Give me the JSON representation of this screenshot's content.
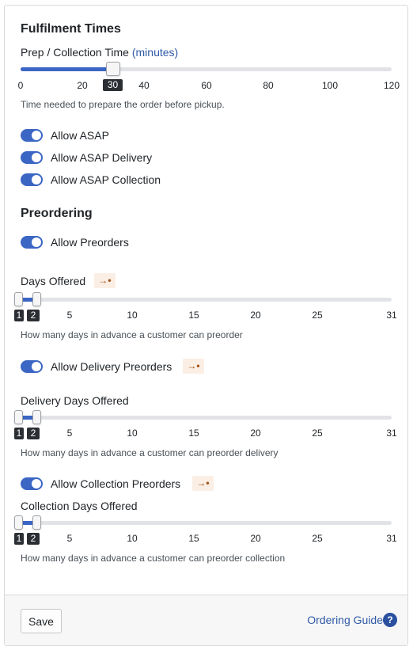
{
  "fulfilment": {
    "title": "Fulfilment Times",
    "prep_label": "Prep / Collection Time",
    "prep_unit": "(minutes)",
    "prep_value": "30",
    "prep_ticks": [
      "0",
      "20",
      "40",
      "60",
      "80",
      "100",
      "120"
    ],
    "prep_help": "Time needed to prepare the order before pickup.",
    "toggles": [
      {
        "label": "Allow ASAP"
      },
      {
        "label": "Allow ASAP Delivery"
      },
      {
        "label": "Allow ASAP Collection"
      }
    ]
  },
  "preordering": {
    "title": "Preordering",
    "allow_preorders": "Allow Preorders",
    "days": {
      "label": "Days Offered",
      "badge_icon": "arrow-in-icon",
      "badge_glyph": "→•",
      "value_min": "1",
      "value_max": "2",
      "ticks": [
        "5",
        "10",
        "15",
        "20",
        "25",
        "31"
      ],
      "help": "How many days in advance a customer can preorder"
    },
    "delivery_toggle": "Allow Delivery Preorders",
    "delivery_days": {
      "label": "Delivery Days Offered",
      "value_min": "1",
      "value_max": "2",
      "ticks": [
        "5",
        "10",
        "15",
        "20",
        "25",
        "31"
      ],
      "help": "How many days in advance a customer can preorder delivery"
    },
    "collection_toggle": "Allow Collection Preorders",
    "collection_days": {
      "label": "Collection Days Offered",
      "value_min": "1",
      "value_max": "2",
      "ticks": [
        "5",
        "10",
        "15",
        "20",
        "25",
        "31"
      ],
      "help": "How many days in advance a customer can preorder collection"
    }
  },
  "footer": {
    "save_label": "Save",
    "guide_label": "Ordering Guide",
    "help_glyph": "?"
  },
  "colors": {
    "accent": "#3b66c4",
    "link": "#2f5aa8",
    "badge_bg": "#fbeee4",
    "tooltip_bg": "#2b2f33"
  }
}
